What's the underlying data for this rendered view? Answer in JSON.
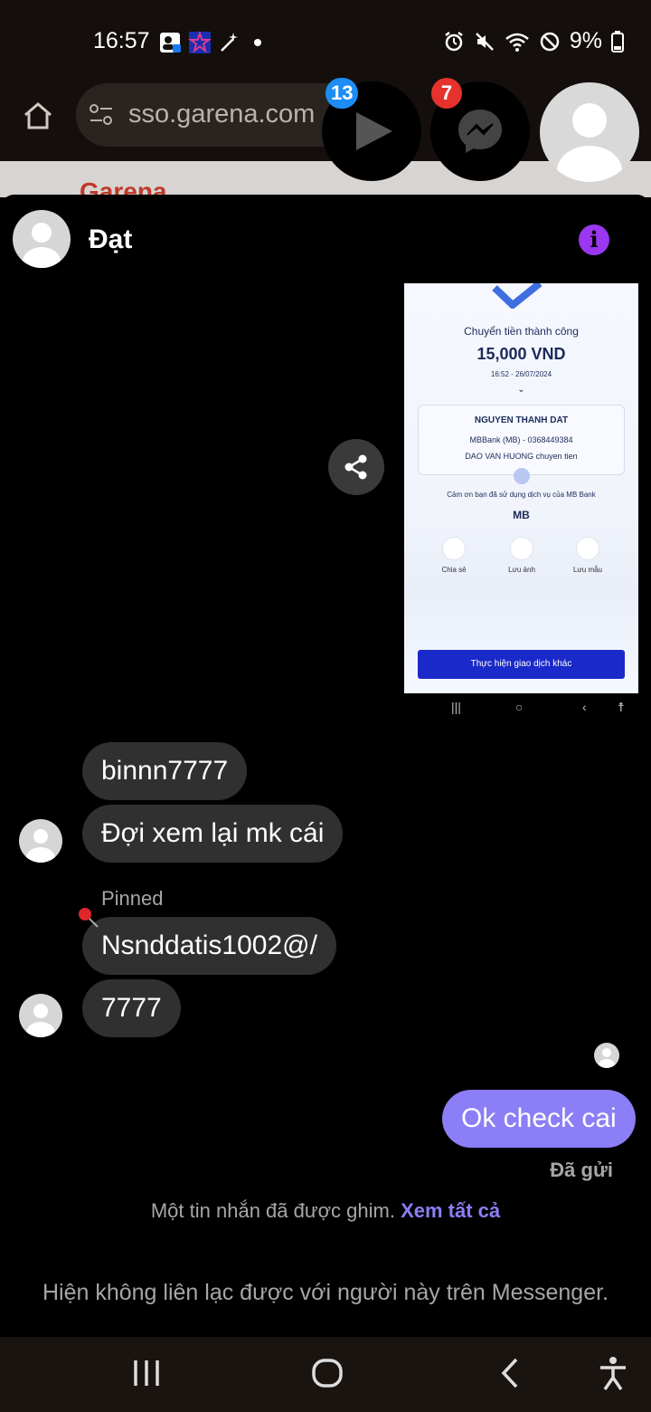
{
  "status_bar": {
    "time": "16:57",
    "battery": "9%",
    "icons": [
      "contact-icon",
      "mb-bank-icon",
      "magic-wand-icon",
      "dot-icon",
      "alarm-icon",
      "mute-icon",
      "wifi-icon",
      "do-not-disturb-icon",
      "battery-icon"
    ]
  },
  "browser": {
    "url": "sso.garena.com",
    "site_logo": "Garena"
  },
  "chat_heads": {
    "video_badge": "13",
    "messenger_badge": "7"
  },
  "chat": {
    "contact_name": "Đạt",
    "receipt": {
      "title": "Chuyển tiền thành công",
      "amount": "15,000 VND",
      "datetime": "16:52 - 26/07/2024",
      "recipient_name": "NGUYEN THANH DAT",
      "recipient_bank": "MBBank (MB) - 0368449384",
      "note": "DAO VAN HUONG chuyen tien",
      "thanks": "Cảm ơn bạn đã sử dụng dịch vụ của MB Bank",
      "brand": "MB",
      "actions": [
        "Chia sẻ",
        "Lưu ảnh",
        "Lưu mẫu"
      ],
      "cta": "Thực hiện giao dịch khác"
    },
    "messages": [
      {
        "text": "binnn7777"
      },
      {
        "text": "Đợi xem lại mk cái"
      },
      {
        "text": "Nsnddatis1002@/"
      },
      {
        "text": "7777"
      }
    ],
    "pinned_label": "Pinned",
    "sent_message": "Ok check cai",
    "sent_status": "Đã gửi",
    "pin_notice": "Một tin nhắn đã được ghim.",
    "pin_notice_link": "Xem tất cả",
    "unavailable_notice": "Hiện không liên lạc được với người này trên Messenger."
  },
  "colors": {
    "accent": "#8b7ef6",
    "info": "#9b37f0",
    "bubble": "#303030",
    "badge_blue": "#1d8df4",
    "badge_red": "#e5322c"
  }
}
